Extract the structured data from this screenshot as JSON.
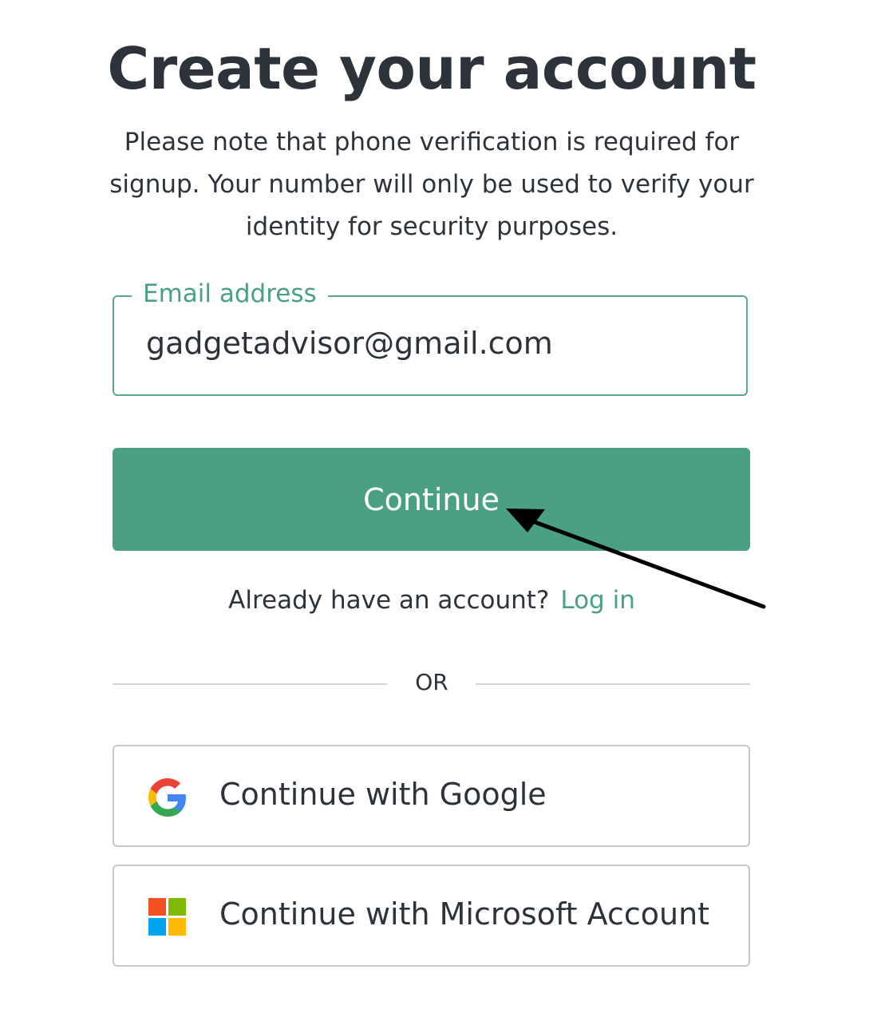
{
  "header": {
    "title": "Create your account",
    "subtitle": "Please note that phone verification is required for signup. Your number will only be used to verify your identity for security purposes."
  },
  "email": {
    "label": "Email address",
    "value": "gadgetadvisor@gmail.com"
  },
  "continue_button": {
    "label": "Continue"
  },
  "login_prompt": {
    "text": "Already have an account?",
    "link": "Log in"
  },
  "divider": {
    "text": "OR"
  },
  "social": {
    "google": {
      "label": "Continue with Google",
      "icon": "google-icon"
    },
    "microsoft": {
      "label": "Continue with Microsoft Account",
      "icon": "microsoft-icon"
    }
  },
  "colors": {
    "accent": "#4aa181",
    "text": "#2d333a",
    "border": "#c2c8d0"
  }
}
